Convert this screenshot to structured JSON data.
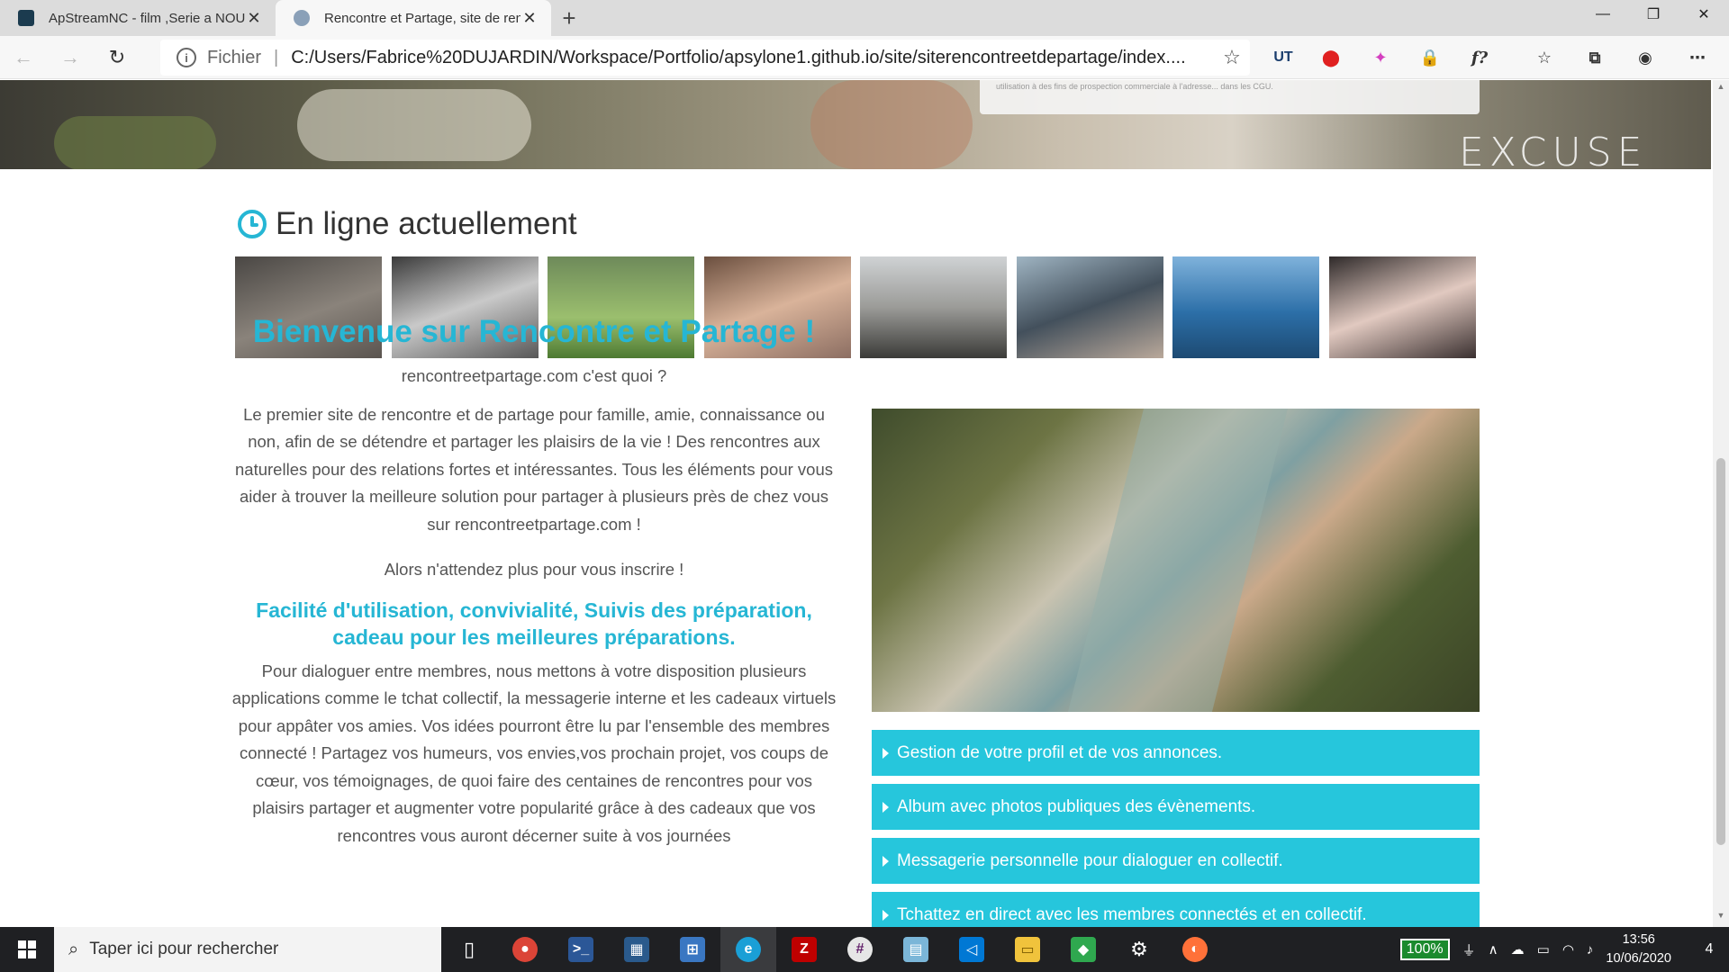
{
  "tabs": [
    {
      "title": "ApStreamNC - film ,Serie a NOU",
      "favicon_color": "#1b3b4f",
      "active": false
    },
    {
      "title": "Rencontre et Partage, site de ren",
      "favicon_color": "#8aa0b8",
      "active": true
    }
  ],
  "toolbar": {
    "scheme": "Fichier",
    "url": "C:/Users/Fabrice%20DUJARDIN/Workspace/Portfolio/apsylone1.github.io/site/siterencontreetdepartage/index....",
    "extensions": [
      "UT",
      "O",
      "✦",
      "🔒",
      "f?",
      "☆≡",
      "⧉",
      "🐼",
      "…"
    ]
  },
  "hero": {
    "form_note": "utilisation à des fins de prospection commerciale à l'adresse... dans les CGU.",
    "logo_text": "EXCUSE"
  },
  "online": {
    "title": "En ligne actuellement",
    "thumbs": [
      {
        "color": "#6b6660"
      },
      {
        "color": "#8e8e8e"
      },
      {
        "color": "#6f8a4f"
      },
      {
        "color": "#a5897a"
      },
      {
        "color": "#8b8b86"
      },
      {
        "color": "#6c7078"
      },
      {
        "color": "#2f6fa8"
      },
      {
        "color": "#7a6a6a"
      }
    ]
  },
  "welcome": {
    "title": "Bienvenue sur Rencontre et Partage !",
    "question": "rencontreetpartage.com c'est quoi ?",
    "intro": "Le premier site de rencontre et de partage pour famille, amie, connaissance ou non, afin de se détendre et partager les plaisirs de la vie ! Des rencontres aux naturelles pour des relations fortes et intéressantes. Tous les éléments pour vous aider à trouver la meilleure solution pour partager à plusieurs près de chez vous sur rencontreetpartage.com !",
    "cta": "Alors n'attendez plus pour vous inscrire !",
    "subtitle": "Facilité d'utilisation, convivialité, Suivis des préparation, cadeau pour les meilleures préparations.",
    "body": "Pour dialoguer entre membres, nous mettons à votre disposition plusieurs applications comme le tchat collectif, la messagerie interne et les cadeaux virtuels pour appâter vos amies. Vos idées pourront être lu par l'ensemble des membres connecté ! Partagez vos humeurs, vos envies,vos prochain projet, vos coups de cœur, vos témoignages, de quoi faire des centaines de rencontres pour vos plaisirs partager et augmenter votre popularité grâce à des cadeaux que vos rencontres vous auront décerner suite à vos journées"
  },
  "features": [
    "Gestion de votre profil et de vos annonces.",
    "Album avec photos publiques des évènements.",
    "Messagerie personnelle pour dialoguer en collectif.",
    "Tchattez en direct avec les membres connectés et en collectif."
  ],
  "taskbar": {
    "search_placeholder": "Taper ici pour rechercher",
    "apps": [
      {
        "name": "task-view",
        "glyph": "▯▯",
        "color": "#1f2023"
      },
      {
        "name": "chrome",
        "glyph": "◉",
        "color": "#db4437"
      },
      {
        "name": "powershell",
        "glyph": ">_",
        "color": "#2b5797"
      },
      {
        "name": "network-app",
        "glyph": "▦",
        "color": "#2a5a8c"
      },
      {
        "name": "remote-desktop",
        "glyph": "⊞",
        "color": "#3a77c2"
      },
      {
        "name": "edge",
        "glyph": "e",
        "color": "#1a9fd6"
      },
      {
        "name": "filezilla",
        "glyph": "Z",
        "color": "#bf0000"
      },
      {
        "name": "slack",
        "glyph": "#",
        "color": "#e6e6e6"
      },
      {
        "name": "notepad",
        "glyph": "▤",
        "color": "#7bb6d8"
      },
      {
        "name": "vscode",
        "glyph": "◁",
        "color": "#0078d4"
      },
      {
        "name": "file-explorer",
        "glyph": "▭",
        "color": "#f0c33c"
      },
      {
        "name": "git",
        "glyph": "◆",
        "color": "#2fa84f"
      },
      {
        "name": "settings",
        "glyph": "⚙",
        "color": "#1f2023"
      },
      {
        "name": "firefox",
        "glyph": "◐",
        "color": "#ff7139"
      }
    ],
    "battery": "100%",
    "time": "13:56",
    "date": "10/06/2020",
    "notifications": "4"
  },
  "colors": {
    "accent": "#26b6d4",
    "feature_bg": "#26c6dc"
  }
}
